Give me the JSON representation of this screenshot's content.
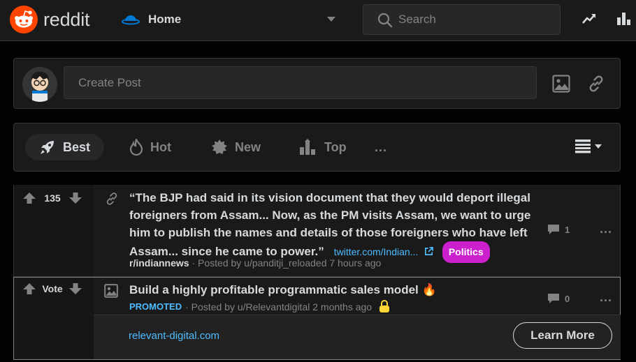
{
  "header": {
    "logo_text": "reddit",
    "feed_label": "Home",
    "search_placeholder": "Search"
  },
  "create_post": {
    "placeholder": "Create Post"
  },
  "sort": {
    "items": [
      {
        "label": "Best",
        "icon": "rocket-icon",
        "active": true
      },
      {
        "label": "Hot",
        "icon": "flame-icon",
        "active": false
      },
      {
        "label": "New",
        "icon": "sun-icon",
        "active": false
      },
      {
        "label": "Top",
        "icon": "bar-chart-icon",
        "active": false
      }
    ],
    "more_label": "..."
  },
  "posts": [
    {
      "votes": "135",
      "title_lines": [
        "“The BJP had said in its vision document that they would deport illegal",
        "foreigners from Assam... Now, as the PM visits Assam, we want to urge",
        "him to publish the names and details of those foreigners who have left",
        "Assam... since he came to power.”"
      ],
      "domain": "twitter.com/Indian...",
      "flair": "Politics",
      "subreddit": "r/indiannews",
      "meta": "· Posted by u/panditji_reloaded 7 hours ago",
      "comments": "1",
      "more": "..."
    },
    {
      "votes": "Vote",
      "title": "Build a highly profitable programmatic sales model 🔥",
      "promoted_label": "PROMOTED",
      "meta": "· Posted by u/Relevantdigital 2 months ago",
      "comments": "0",
      "more": "...",
      "promo_domain": "relevant-digital.com",
      "cta": "Learn More"
    }
  ],
  "colors": {
    "brand": "#ff4500",
    "flair": "#cc1fce",
    "link": "#4fbcff",
    "promoted": "#4fbcff"
  }
}
